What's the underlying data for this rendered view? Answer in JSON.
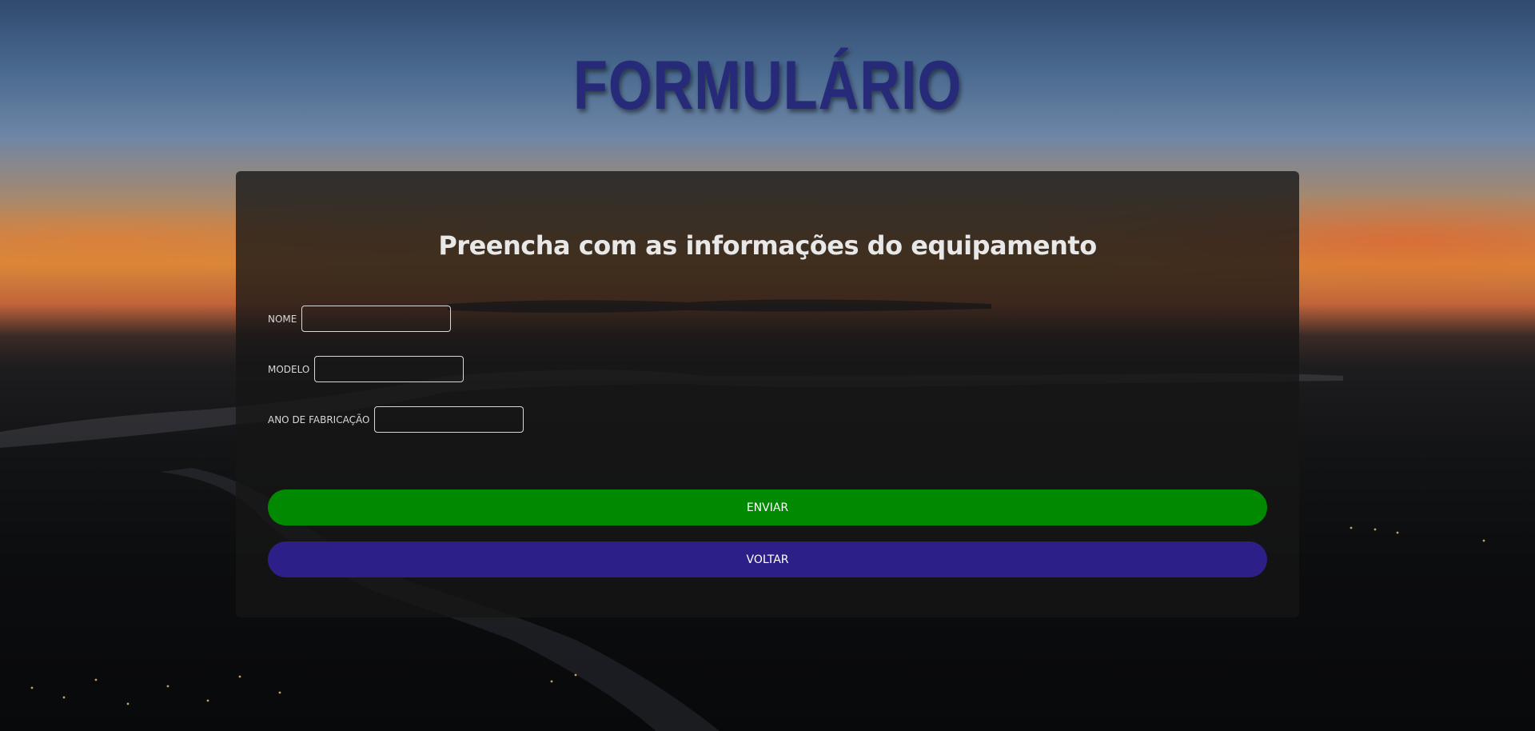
{
  "page": {
    "title": "FORMULÁRIO"
  },
  "form": {
    "heading": "Preencha com as informações do equipamento",
    "fields": [
      {
        "label": "NOME",
        "value": "",
        "placeholder": ""
      },
      {
        "label": "MODELO",
        "value": "",
        "placeholder": ""
      },
      {
        "label": "ANO DE FABRICAÇÃO",
        "value": "",
        "placeholder": ""
      }
    ],
    "submit_label": "ENVIAR",
    "back_label": "VOLTAR"
  },
  "colors": {
    "title": "#262a78",
    "submit_button": "#028902",
    "back_button": "#2c2088",
    "card_background": "#161616"
  }
}
